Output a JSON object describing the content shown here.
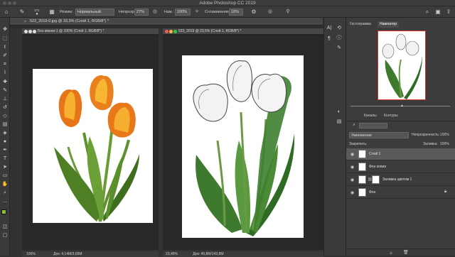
{
  "window": {
    "title": "Adobe Photoshop CC 2019"
  },
  "options": {
    "brush_size": "171",
    "mode_label": "Режим:",
    "mode_value": "Нормальный",
    "opacity_label": "Непрозр.:",
    "opacity_value": "27%",
    "pressure_label": "Наж.:",
    "pressure_value": "100%",
    "smoothing_label": "Сглаживание:",
    "smoothing_value": "10%"
  },
  "docs": [
    {
      "tab": "522_2019-0.jpg @ 33,3% (Слой 1, RGB/8*) *",
      "tab2": "Без имени-1 @ 100% (Слой 1, RGB/8*) *",
      "zoom": "100%",
      "doc_size": "Док: 4,14М/3,65М"
    },
    {
      "tab": "523_2019 @ 23,5% (Слой 1, RGB/8*) *",
      "zoom": "23,46%",
      "doc_size": "Док: 45,8М/143,8М"
    }
  ],
  "panels": {
    "tab_histogram": "Гистограмма",
    "tab_navigator": "Навигатор",
    "tab_channels": "Каналы",
    "tab_paths": "Контуры",
    "blend_mode": "Умножение",
    "opacity_label": "Непрозрачность:",
    "opacity_value": "100%",
    "lock_label": "Закрепить:",
    "fill_label": "Заливка:",
    "fill_value": "100%",
    "layers": [
      {
        "name": "Слой 1"
      },
      {
        "name": "Фон копия"
      },
      {
        "name": "Заливка цветом 1"
      },
      {
        "name": "Фон"
      }
    ]
  },
  "colors": {
    "foreground": "#8dc21f",
    "background": "#ffffff",
    "accent": "#2d7fd1"
  }
}
